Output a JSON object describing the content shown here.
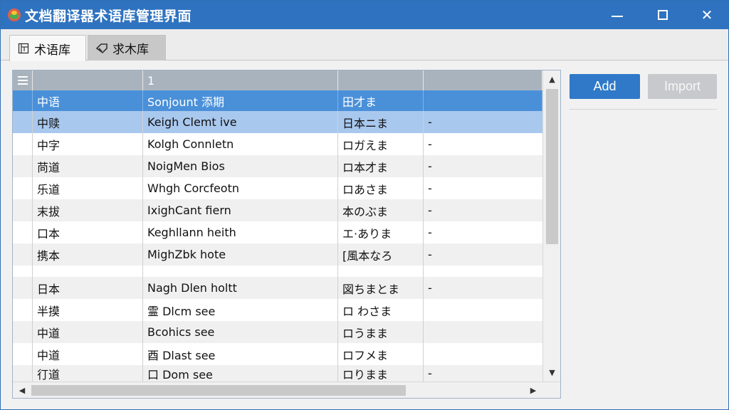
{
  "window": {
    "title": "文档翻译器术语库管理界面",
    "controls": {
      "minimize": "—",
      "maximize": "□",
      "close": "✕"
    }
  },
  "tabs": [
    {
      "label": "术语库",
      "icon": "table-icon",
      "active": true
    },
    {
      "label": "求木库",
      "icon": "tag-icon",
      "active": false
    }
  ],
  "grid": {
    "header_row1": {
      "col2": "1"
    },
    "header_row2": {
      "zh": "中语",
      "src": "Sonjount 添期",
      "ja": "田才ま"
    },
    "rows": [
      {
        "zh": "中赎",
        "src": "Keigh Clemt ive",
        "ja": "日本ニま",
        "x": "-"
      },
      {
        "zh": "中字",
        "src": "Kolgh Connletn",
        "ja": "ロガえま",
        "x": "-"
      },
      {
        "zh": "苘道",
        "src": "NoigMen Bios",
        "ja": "ロ本才ま",
        "x": "-"
      },
      {
        "zh": "乐道",
        "src": "Whgh Corcfeotn",
        "ja": "ロあさま",
        "x": "-"
      },
      {
        "zh": "末拔",
        "src": "IxighCant fiern",
        "ja": "本のぶま",
        "x": "-"
      },
      {
        "zh": "口本",
        "src": "Keghllann heith",
        "ja": "エ·ありま",
        "x": "-"
      },
      {
        "zh": "携本",
        "src": "MighZbk hote",
        "ja": "[風本なろ",
        "x": "-"
      },
      {
        "zh": "",
        "src": "",
        "ja": "",
        "x": ""
      },
      {
        "zh": "日本",
        "src": "Nagh Dlen holtt",
        "ja": "図ちまとま",
        "x": "-"
      },
      {
        "zh": "半摸",
        "src": "霊 Dlcm see",
        "ja": "ロ わさま",
        "x": ""
      },
      {
        "zh": "中道",
        "src": "Bcohics see",
        "ja": "ロうまま",
        "x": ""
      },
      {
        "zh": "中道",
        "src": "酉 Dlast see",
        "ja": "ロフメま",
        "x": ""
      },
      {
        "zh": "㣔道",
        "src": "口 Dom see",
        "ja": "ロりまま",
        "x": "-"
      }
    ]
  },
  "scrollbars": {
    "up": "▲",
    "down": "▼",
    "left": "◀",
    "right": "▶"
  },
  "buttons": {
    "add": "Add",
    "import": "Import"
  },
  "colors": {
    "titlebar": "#2f73c0",
    "header": "#4a90d9",
    "selected_row": "#a9c8ee",
    "add_button": "#2f79c8"
  }
}
